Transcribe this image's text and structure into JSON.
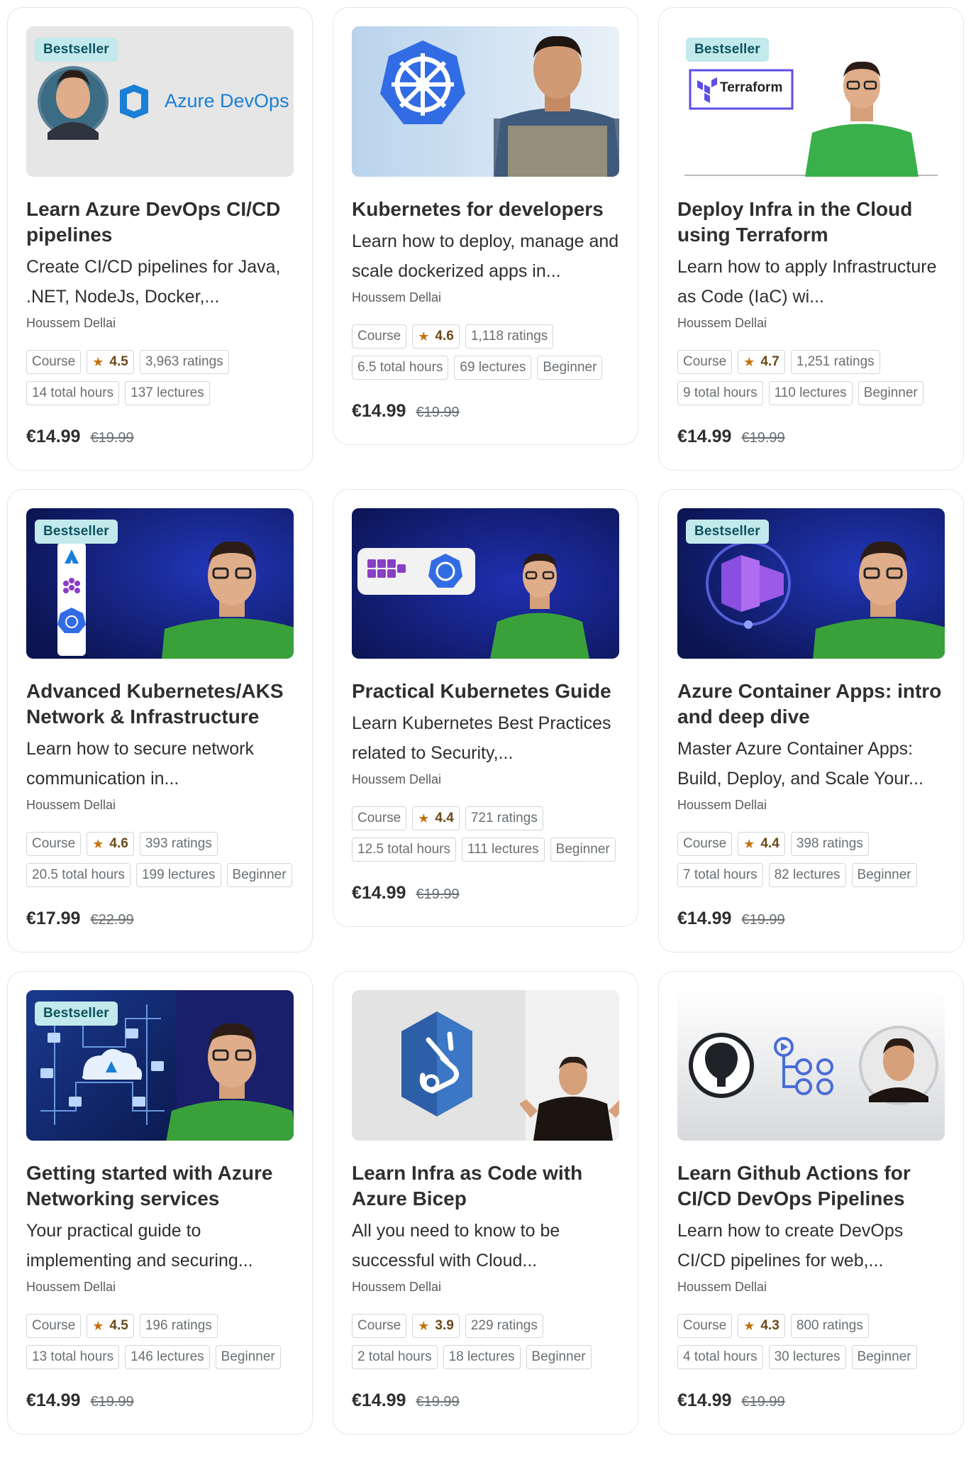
{
  "courses": [
    {
      "badge": "Bestseller",
      "thumb_text": "Azure DevOps",
      "title": "Learn Azure DevOps CI/CD pipelines",
      "subtitle": "Create CI/CD pipelines for Java, .NET, NodeJs, Docker,...",
      "author": "Houssem Dellai",
      "type": "Course",
      "rating": "4.5",
      "ratings": "3,963 ratings",
      "hours": "14 total hours",
      "lectures": "137 lectures",
      "level": "",
      "price": "€14.99",
      "old_price": "€19.99"
    },
    {
      "badge": "",
      "thumb_text": "",
      "title": "Kubernetes for developers",
      "subtitle": "Learn how to deploy, manage and scale dockerized apps in...",
      "author": "Houssem Dellai",
      "type": "Course",
      "rating": "4.6",
      "ratings": "1,118 ratings",
      "hours": "6.5 total hours",
      "lectures": "69 lectures",
      "level": "Beginner",
      "price": "€14.99",
      "old_price": "€19.99"
    },
    {
      "badge": "Bestseller",
      "thumb_text": "Terraform",
      "title": "Deploy Infra in the Cloud using Terraform",
      "subtitle": "Learn how to apply Infrastructure as Code (IaC) wi...",
      "author": "Houssem Dellai",
      "type": "Course",
      "rating": "4.7",
      "ratings": "1,251 ratings",
      "hours": "9 total hours",
      "lectures": "110 lectures",
      "level": "Beginner",
      "price": "€14.99",
      "old_price": "€19.99"
    },
    {
      "badge": "Bestseller",
      "thumb_text": "",
      "title": "Advanced Kubernetes/AKS Network & Infrastructure",
      "subtitle": "Learn how to secure network communication in...",
      "author": "Houssem Dellai",
      "type": "Course",
      "rating": "4.6",
      "ratings": "393 ratings",
      "hours": "20.5 total hours",
      "lectures": "199 lectures",
      "level": "Beginner",
      "price": "€17.99",
      "old_price": "€22.99"
    },
    {
      "badge": "",
      "thumb_text": "",
      "title": "Practical Kubernetes Guide",
      "subtitle": "Learn Kubernetes Best Practices related to Security,...",
      "author": "Houssem Dellai",
      "type": "Course",
      "rating": "4.4",
      "ratings": "721 ratings",
      "hours": "12.5 total hours",
      "lectures": "111 lectures",
      "level": "Beginner",
      "price": "€14.99",
      "old_price": "€19.99"
    },
    {
      "badge": "Bestseller",
      "thumb_text": "",
      "title": "Azure Container Apps: intro and deep dive",
      "subtitle": "Master Azure Container Apps: Build, Deploy, and Scale Your...",
      "author": "Houssem Dellai",
      "type": "Course",
      "rating": "4.4",
      "ratings": "398 ratings",
      "hours": "7 total hours",
      "lectures": "82 lectures",
      "level": "Beginner",
      "price": "€14.99",
      "old_price": "€19.99"
    },
    {
      "badge": "Bestseller",
      "thumb_text": "",
      "title": "Getting started with Azure Networking services",
      "subtitle": "Your practical guide to implementing and securing...",
      "author": "Houssem Dellai",
      "type": "Course",
      "rating": "4.5",
      "ratings": "196 ratings",
      "hours": "13 total hours",
      "lectures": "146 lectures",
      "level": "Beginner",
      "price": "€14.99",
      "old_price": "€19.99"
    },
    {
      "badge": "",
      "thumb_text": "",
      "title": "Learn Infra as Code with Azure Bicep",
      "subtitle": "All you need to know to be successful with Cloud...",
      "author": "Houssem Dellai",
      "type": "Course",
      "rating": "3.9",
      "ratings": "229 ratings",
      "hours": "2 total hours",
      "lectures": "18 lectures",
      "level": "Beginner",
      "price": "€14.99",
      "old_price": "€19.99"
    },
    {
      "badge": "",
      "thumb_text": "",
      "title": "Learn Github Actions for CI/CD DevOps Pipelines",
      "subtitle": "Learn how to create DevOps CI/CD pipelines for web,...",
      "author": "Houssem Dellai",
      "type": "Course",
      "rating": "4.3",
      "ratings": "800 ratings",
      "hours": "4 total hours",
      "lectures": "30 lectures",
      "level": "Beginner",
      "price": "€14.99",
      "old_price": "€19.99"
    }
  ],
  "colors": {
    "badge_bg": "#c2e9eb",
    "badge_text": "#0d5261",
    "star": "#c4710d",
    "card_border": "#e4e6e8"
  }
}
